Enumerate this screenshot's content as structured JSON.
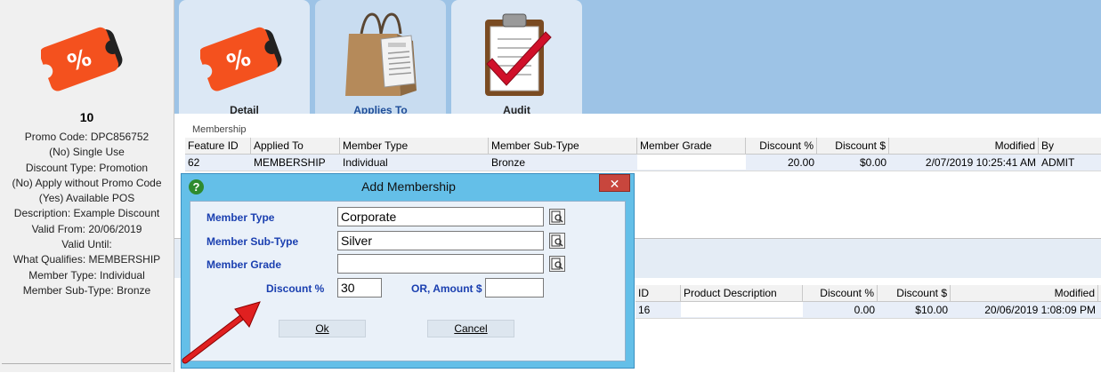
{
  "left_panel": {
    "promo_id": "10",
    "lines": [
      "Promo Code: DPC856752",
      "(No) Single Use",
      "Discount Type: Promotion",
      "(No) Apply without Promo Code",
      "(Yes) Available POS",
      "Description: Example Discount",
      "Valid From: 20/06/2019",
      "Valid Until:",
      "What Qualifies: MEMBERSHIP",
      "Member Type: Individual",
      "Member Sub-Type: Bronze"
    ],
    "logo_icon": "discount-tag-icon"
  },
  "tabs": [
    {
      "label": "Detail",
      "icon": "discount-tag-icon"
    },
    {
      "label": "Applies To",
      "icon": "shopping-bag-icon"
    },
    {
      "label": "Audit",
      "icon": "clipboard-check-icon"
    }
  ],
  "membership": {
    "section_title": "Membership",
    "columns": [
      "Feature ID",
      "Applied To",
      "Member Type",
      "Member Sub-Type",
      "Member Grade",
      "Discount %",
      "Discount $",
      "Modified",
      "By"
    ],
    "rows": [
      {
        "feature_id": "62",
        "applied_to": "MEMBERSHIP",
        "member_type": "Individual",
        "member_sub_type": "Bronze",
        "member_grade": "",
        "discount_pct": "20.00",
        "discount_amt": "$0.00",
        "modified": "2/07/2019 10:25:41 AM",
        "by": "ADMIT"
      }
    ]
  },
  "products": {
    "columns": [
      "ID",
      "Product Description",
      "Discount %",
      "Discount $",
      "Modified"
    ],
    "rows": [
      {
        "id": "16",
        "description": "",
        "discount_pct": "0.00",
        "discount_amt": "$10.00",
        "modified": "20/06/2019 1:08:09 PM"
      }
    ]
  },
  "dialog": {
    "title": "Add Membership",
    "help_label": "?",
    "close_label": "✕",
    "member_type_label": "Member Type",
    "member_type_value": "Corporate",
    "member_sub_type_label": "Member Sub-Type",
    "member_sub_type_value": "Silver",
    "member_grade_label": "Member Grade",
    "member_grade_value": "",
    "discount_pct_label": "Discount %",
    "discount_pct_value": "30",
    "amount_label": "OR, Amount $",
    "amount_value": "",
    "ok_label": "Ok",
    "cancel_label": "Cancel"
  },
  "colors": {
    "tab_area": "#9dc3e6",
    "dialog_frame": "#64bfe8",
    "label_blue": "#1a3fb0",
    "arrow_red": "#e02020"
  }
}
